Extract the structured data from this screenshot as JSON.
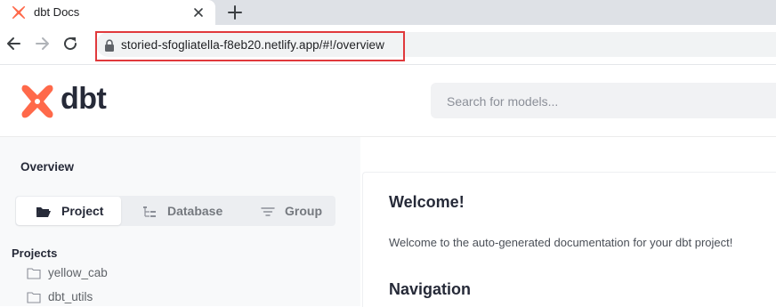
{
  "browser": {
    "tab_title": "dbt Docs",
    "url": "storied-sfogliatella-f8eb20.netlify.app/#!/overview"
  },
  "header": {
    "logo_text": "dbt",
    "search_placeholder": "Search for models..."
  },
  "sidebar": {
    "heading": "Overview",
    "tabs": [
      {
        "label": "Project",
        "icon": "folder-open-icon",
        "active": true
      },
      {
        "label": "Database",
        "icon": "tree-icon",
        "active": false
      },
      {
        "label": "Group",
        "icon": "filter-lines-icon",
        "active": false
      }
    ],
    "projects_heading": "Projects",
    "projects": [
      {
        "label": "yellow_cab",
        "icon": "folder-icon"
      },
      {
        "label": "dbt_utils",
        "icon": "folder-icon"
      }
    ]
  },
  "main": {
    "welcome_title": "Welcome!",
    "welcome_text": "Welcome to the auto-generated documentation for your dbt project!",
    "navigation_title": "Navigation"
  },
  "colors": {
    "brand": "#ff694a",
    "highlight": "#e0393c",
    "text_dark": "#262a38"
  }
}
